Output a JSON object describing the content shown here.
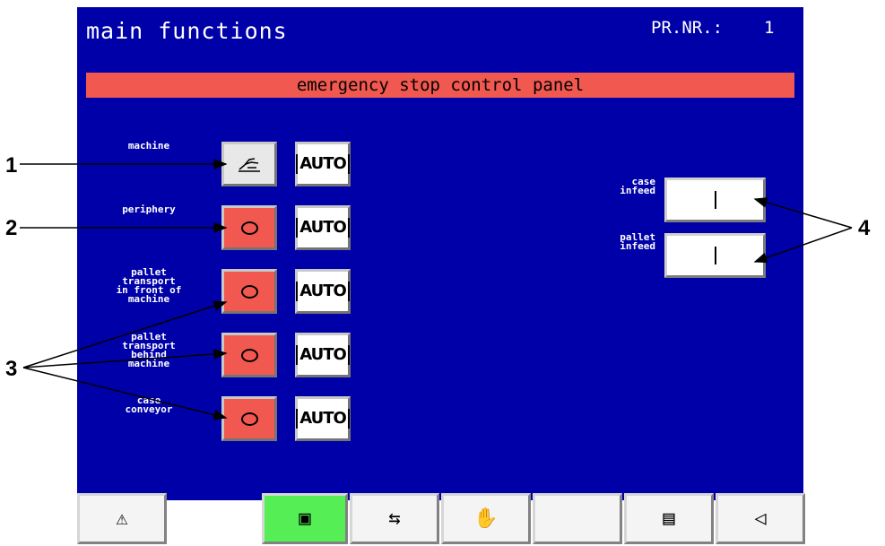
{
  "header": {
    "title": "main functions",
    "prnr_label": "PR.NR.:",
    "prnr_value": "1"
  },
  "banner": {
    "text": "emergency stop control panel"
  },
  "rows": [
    {
      "label": "machine",
      "mode": "manual-hand",
      "auto_label": "AUTO"
    },
    {
      "label": "periphery",
      "mode": "off",
      "auto_label": "AUTO"
    },
    {
      "label": "pallet\ntransport\nin front of\nmachine",
      "mode": "off",
      "auto_label": "AUTO"
    },
    {
      "label": "pallet\ntransport\nbehind\nmachine",
      "mode": "off",
      "auto_label": "AUTO"
    },
    {
      "label": "case\nconveyor",
      "mode": "off",
      "auto_label": "AUTO"
    }
  ],
  "infeeds": [
    {
      "label": "case\ninfeed",
      "state": "on"
    },
    {
      "label": "pallet\ninfeed",
      "state": "on"
    }
  ],
  "callouts": [
    "1",
    "2",
    "3",
    "4"
  ],
  "footer": [
    {
      "icon": "warning-icon",
      "glyph": "⚠"
    },
    {
      "icon": "main-functions-icon",
      "glyph": "▣",
      "active": true
    },
    {
      "icon": "transfer-icon",
      "glyph": "⇆"
    },
    {
      "icon": "hand-icon",
      "glyph": "✋"
    },
    {
      "icon": "blank",
      "glyph": ""
    },
    {
      "icon": "pages-icon",
      "glyph": "▤"
    },
    {
      "icon": "back-icon",
      "glyph": "◁"
    }
  ],
  "colors": {
    "screen": "#0000a8",
    "alarm": "#f05850",
    "active": "#55ee55"
  }
}
